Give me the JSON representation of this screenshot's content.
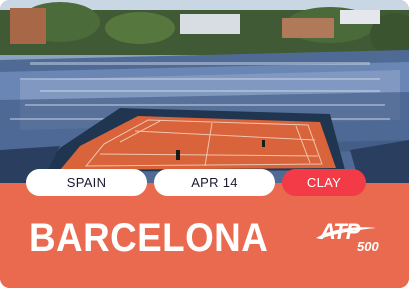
{
  "tournament": {
    "country": "SPAIN",
    "date": "APR 14",
    "surface": "CLAY",
    "city": "BARCELONA",
    "tier_brand": "ATP",
    "tier_level": "500"
  },
  "image": {
    "subject_icon": "stadium-photo"
  },
  "colors": {
    "band": "#ea6a50",
    "surface_badge": "#f23b46",
    "pill": "#ffffff",
    "court": "#d9633a"
  }
}
